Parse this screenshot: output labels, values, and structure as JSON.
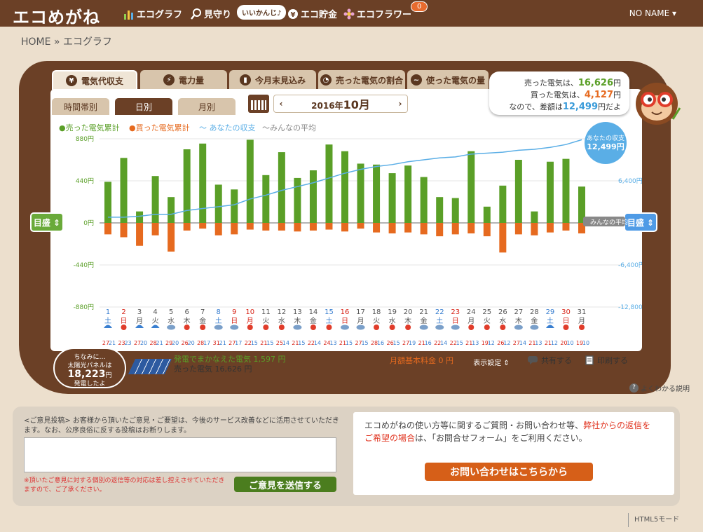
{
  "header": {
    "logo": "エコめがね",
    "nav": [
      {
        "label": "エコグラフ",
        "icon": "bar-chart-icon"
      },
      {
        "label": "見守り",
        "icon": "magnifier-icon"
      },
      {
        "label": "エコ貯金",
        "icon": "coin-icon"
      },
      {
        "label": "エコフラワー",
        "icon": "flower-icon"
      }
    ],
    "bubble": "いいかんじ♪",
    "flower_badge": "0",
    "user": "NO NAME ▾"
  },
  "breadcrumb": "HOME » エコグラフ",
  "tabs": [
    {
      "label": "電気代収支",
      "icon": "¥"
    },
    {
      "label": "電力量",
      "icon": "⚡"
    },
    {
      "label": "今月末見込み",
      "icon": "▮"
    },
    {
      "label": "売った電気の割合",
      "icon": "◔"
    },
    {
      "label": "使った電気の量",
      "icon": "~"
    }
  ],
  "subtabs": [
    "時間帯別",
    "日別",
    "月別"
  ],
  "date_nav": {
    "prev": "‹",
    "next": "›",
    "year": "2016年",
    "month": "10月"
  },
  "summary": {
    "line1_pre": "売った電気は、",
    "line1_val": "16,626",
    "line1_unit": "円",
    "line2_pre": "買った電気は、",
    "line2_val": "4,127",
    "line2_unit": "円",
    "line3_pre": "なので、差額は",
    "line3_val": "12,499",
    "line3_unit": "円だよ"
  },
  "scale_buttons": {
    "left": "目盛 ⇕",
    "right": "目盛 ⇕"
  },
  "chart_data": {
    "type": "bar",
    "legend": [
      "●売った電気累計",
      "●買った電気累計",
      "〜 あなたの収支",
      "〜みんなの平均"
    ],
    "yleft": {
      "ticks": [
        "880円",
        "440円",
        "0円",
        "-440円",
        "-880円"
      ],
      "range": [
        -880,
        880
      ]
    },
    "yright": {
      "ticks": [
        "6,400円",
        "-6,400円",
        "-12,800円"
      ]
    },
    "days": [
      "1",
      "2",
      "3",
      "4",
      "5",
      "6",
      "7",
      "8",
      "9",
      "10",
      "11",
      "12",
      "13",
      "14",
      "15",
      "16",
      "17",
      "18",
      "19",
      "20",
      "21",
      "22",
      "23",
      "24",
      "25",
      "26",
      "27",
      "28",
      "29",
      "30",
      "31"
    ],
    "weekdays": [
      "土",
      "日",
      "月",
      "火",
      "水",
      "木",
      "金",
      "土",
      "日",
      "月",
      "火",
      "水",
      "木",
      "金",
      "土",
      "日",
      "月",
      "火",
      "水",
      "木",
      "金",
      "土",
      "日",
      "月",
      "火",
      "水",
      "木",
      "金",
      "土",
      "日",
      "月"
    ],
    "day_colors": [
      "blue",
      "red",
      "",
      "",
      "",
      "",
      "",
      "blue",
      "red",
      "red",
      "",
      "",
      "",
      "",
      "blue",
      "red",
      "",
      "",
      "",
      "",
      "",
      "blue",
      "red",
      "",
      "",
      "",
      "",
      "",
      "blue",
      "red",
      ""
    ],
    "weather": [
      "rain",
      "sun",
      "rain",
      "rain",
      "cloud",
      "sun",
      "sun",
      "cloud",
      "cloud",
      "sun",
      "sun",
      "sun",
      "cloud",
      "sun",
      "sun",
      "cloud",
      "cloud",
      "sun",
      "sun",
      "sun",
      "cloud",
      "cloud",
      "cloud",
      "sun",
      "sun",
      "sun",
      "cloud",
      "cloud",
      "rain",
      "sun",
      "sun"
    ],
    "high": [
      "27",
      "23",
      "27",
      "28",
      "29",
      "26",
      "28",
      "31",
      "27",
      "22",
      "21",
      "25",
      "21",
      "22",
      "24",
      "21",
      "27",
      "28",
      "26",
      "27",
      "21",
      "22",
      "22",
      "21",
      "19",
      "26",
      "27",
      "21",
      "21",
      "20",
      "19"
    ],
    "low": [
      "21",
      "23",
      "20",
      "21",
      "20",
      "20",
      "17",
      "21",
      "17",
      "15",
      "15",
      "14",
      "15",
      "14",
      "13",
      "15",
      "15",
      "16",
      "15",
      "19",
      "16",
      "14",
      "15",
      "13",
      "12",
      "12",
      "14",
      "13",
      "12",
      "10",
      "10"
    ],
    "sold": [
      430,
      680,
      120,
      490,
      270,
      770,
      830,
      400,
      350,
      870,
      500,
      740,
      470,
      550,
      820,
      750,
      620,
      610,
      520,
      600,
      480,
      270,
      260,
      750,
      170,
      390,
      660,
      120,
      640,
      670,
      380
    ],
    "bought": [
      -120,
      -150,
      -240,
      -130,
      -300,
      -80,
      -60,
      -130,
      -120,
      -70,
      -80,
      -80,
      -90,
      -80,
      -70,
      -90,
      -60,
      -100,
      -110,
      -100,
      -120,
      -140,
      -120,
      -110,
      -140,
      -310,
      -120,
      -130,
      -100,
      -80,
      -110
    ],
    "balance_line": [
      60,
      60,
      70,
      90,
      90,
      130,
      150,
      170,
      190,
      250,
      290,
      340,
      380,
      420,
      470,
      520,
      560,
      590,
      610,
      640,
      660,
      680,
      690,
      720,
      730,
      740,
      760,
      770,
      790,
      820,
      870
    ],
    "balance_label": [
      "あなたの収支",
      "12,499円"
    ],
    "average_label": "みんなの平均"
  },
  "solar": {
    "bubble_l1": "ちなみに…",
    "bubble_l2": "太陽光パネルは",
    "bubble_val": "18,223",
    "bubble_unit": "円",
    "bubble_l3": "発電したよ",
    "text1_label": "発電でまかなえた電気",
    "text1_val": "1,597 円",
    "text2_label": "売った電気",
    "text2_val": "16,626 円"
  },
  "controls": {
    "kihon": "月額基本料金 0 円",
    "display": "表示設定 ⇕",
    "share": "共有する",
    "print": "印刷する",
    "help": "よくわかる説明"
  },
  "feedback": {
    "intro": "<ご意見投稿> お客様から頂いたご意見・ご要望は、今後のサービス改善などに活用させていただきます。なお、公序良俗に反する投稿はお断りします。",
    "note": "※頂いたご意見に対する個別の返信等の対応は差し控えさせていただきますので、ご了承ください。",
    "send": "ご意見を送信する"
  },
  "contact": {
    "text_a": "エコめがねの使い方等に関するご質問・お問い合わせ等、",
    "text_b": "弊社からの返信をご希望の場合",
    "text_c": "は、「お問合せフォーム」をご利用ください。",
    "button": "お問い合わせはこちらから"
  },
  "footer": {
    "html5": "HTML5モード"
  },
  "colors": {
    "brown": "#6b4026",
    "green": "#5a9f27",
    "orange": "#e66a1f",
    "blue": "#5aaee6"
  }
}
